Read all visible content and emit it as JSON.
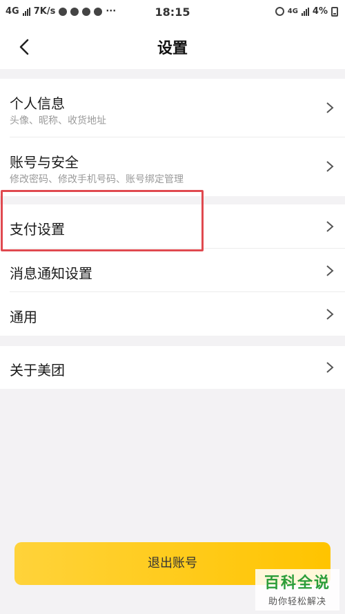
{
  "status_bar": {
    "network": "4G",
    "speed": "7K/s",
    "time": "18:15",
    "network_right": "4G",
    "battery": "4%"
  },
  "header": {
    "title": "设置"
  },
  "sections": [
    {
      "items": [
        {
          "title": "个人信息",
          "subtitle": "头像、昵称、收货地址"
        },
        {
          "title": "账号与安全",
          "subtitle": "修改密码、修改手机号码、账号绑定管理"
        }
      ]
    },
    {
      "items": [
        {
          "title": "支付设置"
        },
        {
          "title": "消息通知设置"
        },
        {
          "title": "通用"
        }
      ]
    },
    {
      "items": [
        {
          "title": "关于美团"
        }
      ]
    }
  ],
  "logout_label": "退出账号",
  "watermark": {
    "title": "百科全说",
    "subtitle": "助你轻松解决"
  },
  "colors": {
    "accent": "#ffc400",
    "highlight": "#e0494f",
    "background": "#f3f2f4"
  }
}
